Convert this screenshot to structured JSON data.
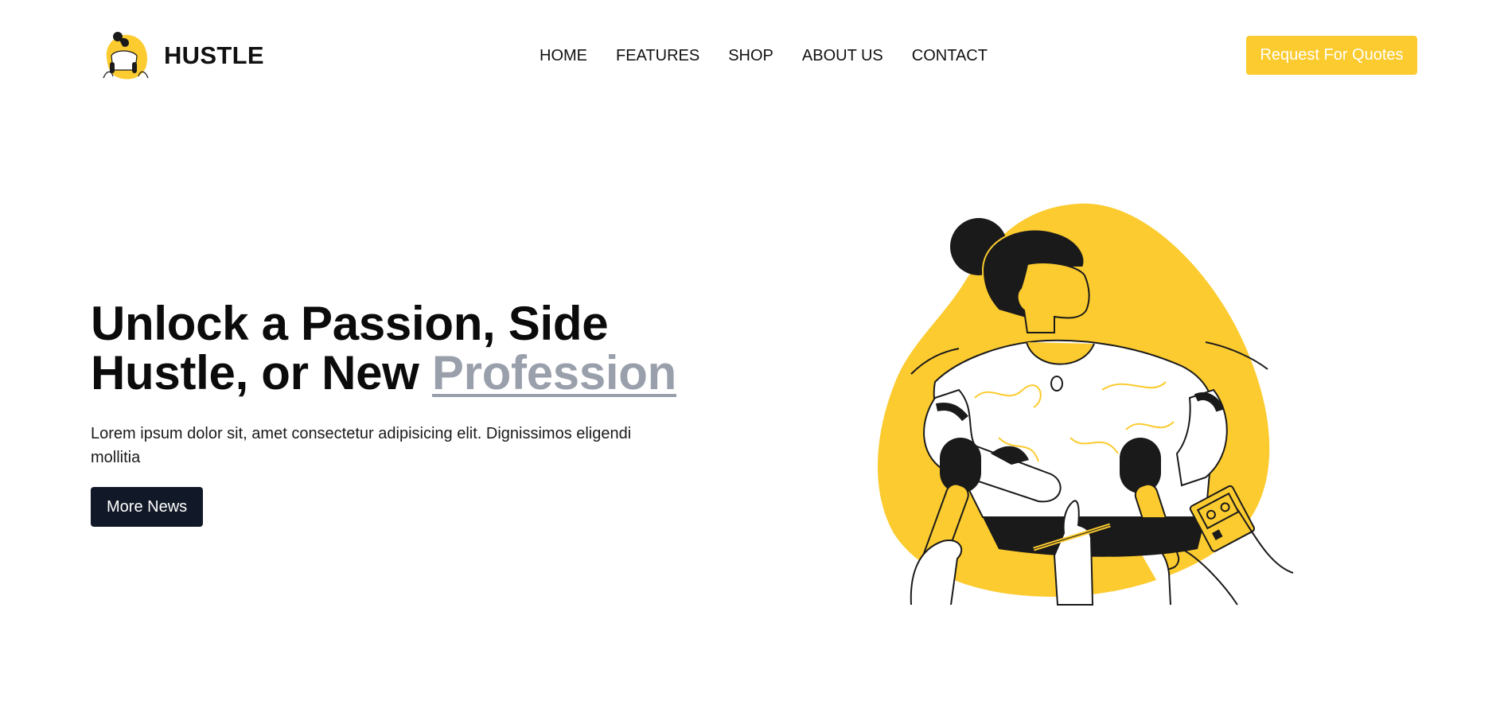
{
  "brand": {
    "name": "HUSTLE",
    "logo_icon": "woman-interview-logo-icon"
  },
  "nav": {
    "items": [
      {
        "label": "HOME"
      },
      {
        "label": "FEATURES"
      },
      {
        "label": "SHOP"
      },
      {
        "label": "ABOUT US"
      },
      {
        "label": "CONTACT"
      }
    ]
  },
  "header": {
    "cta_label": "Request For Quotes"
  },
  "hero": {
    "title_part1": "Unlock a Passion, Side Hustle, or New ",
    "title_highlight": "Profession",
    "description": "Lorem ipsum dolor sit, amet consectetur adipisicing elit. Dignissimos eligendi mollitia",
    "button_label": "More News",
    "illustration": "woman-press-interview-illustration"
  },
  "colors": {
    "accent": "#fccb2f",
    "dark": "#111827",
    "highlight_text": "#9aa0ab",
    "text": "#111111"
  }
}
